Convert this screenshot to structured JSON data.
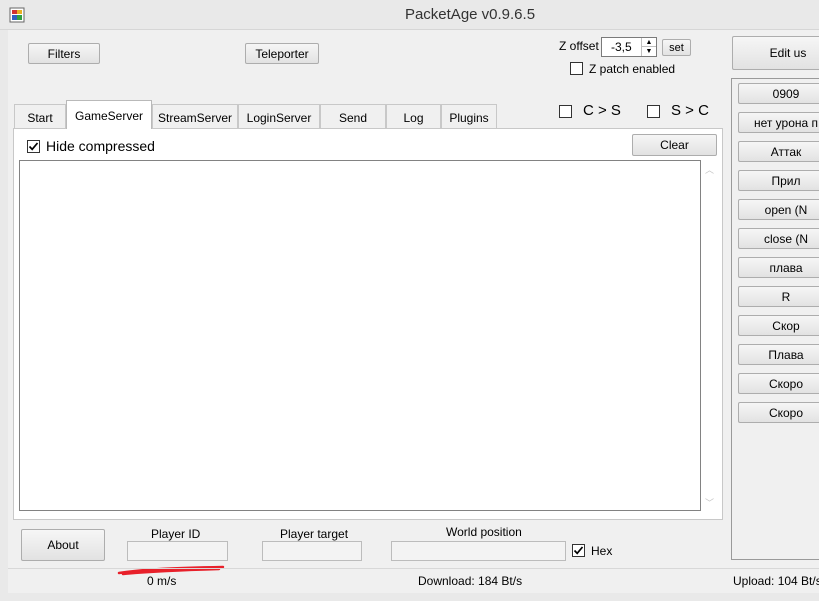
{
  "window": {
    "title": "PacketAge v0.9.6.5",
    "icon": "app-icon"
  },
  "toolbar": {
    "filters_label": "Filters",
    "teleporter_label": "Teleporter",
    "z_offset_label": "Z offset",
    "z_offset_value": "-3,5",
    "set_label": "set",
    "z_patch_label": "Z patch enabled",
    "z_patch_checked": false,
    "edit_label": "Edit us"
  },
  "tabs": [
    {
      "label": "Start",
      "active": false
    },
    {
      "label": "GameServer",
      "active": true
    },
    {
      "label": "StreamServer",
      "active": false
    },
    {
      "label": "LoginServer",
      "active": false
    },
    {
      "label": "Send",
      "active": false
    },
    {
      "label": "Log",
      "active": false
    },
    {
      "label": "Plugins",
      "active": false
    }
  ],
  "direction_filters": {
    "c_to_s_label": "C > S",
    "c_to_s_checked": false,
    "s_to_c_label": "S > C",
    "s_to_c_checked": false
  },
  "gameserver": {
    "hide_compressed_label": "Hide compressed",
    "hide_compressed_checked": true,
    "clear_label": "Clear"
  },
  "side_buttons": [
    "0909",
    "нет урона п",
    "Аттак",
    "Прил",
    "open (N",
    "close (N",
    "плава",
    "R",
    "Скор",
    "Плава",
    "Скоро",
    "Скоро"
  ],
  "bottom": {
    "about_label": "About",
    "player_id_label": "Player ID",
    "player_target_label": "Player target",
    "world_position_label": "World position",
    "hex_label": "Hex",
    "hex_checked": true
  },
  "status": {
    "speed": "0 m/s",
    "download": "Download: 184 Bt/s",
    "upload": "Upload: 104 Bt/s"
  },
  "colors": {
    "window_bg": "#f0f0f0",
    "redaction": "#e8202a"
  }
}
